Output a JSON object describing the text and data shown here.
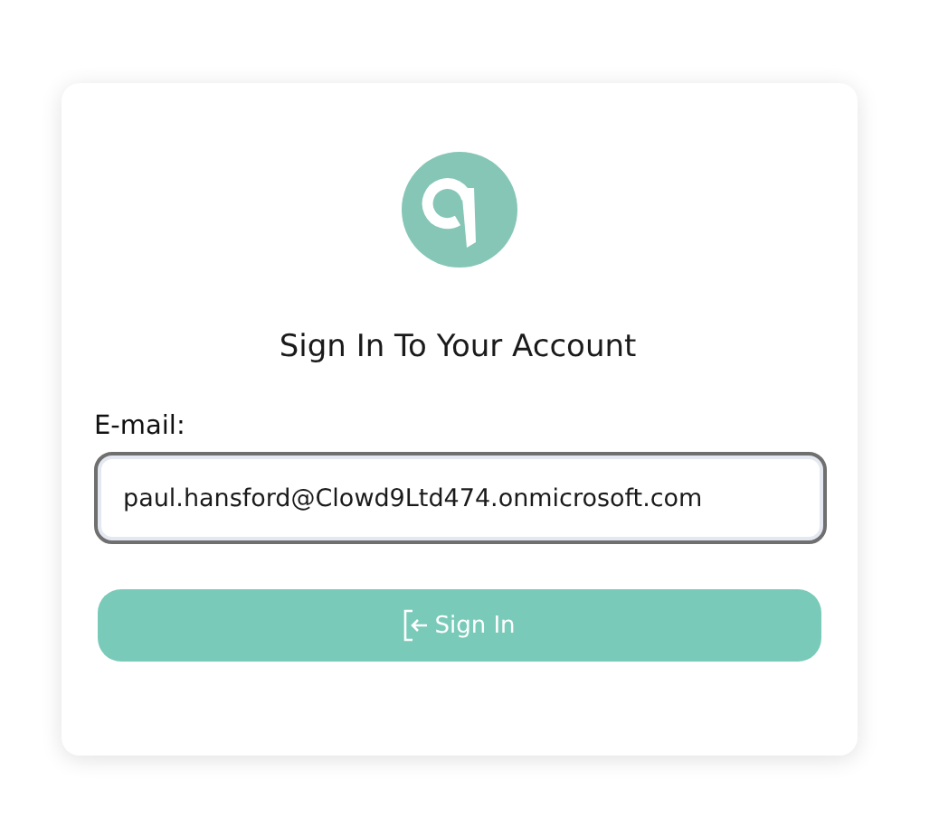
{
  "title": "Sign In To Your Account",
  "email": {
    "label": "E-mail:",
    "value": "paul.hansford@Clowd9Ltd474.onmicrosoft.com",
    "focused": true
  },
  "submit": {
    "label": "Sign In",
    "disabled": true
  }
}
